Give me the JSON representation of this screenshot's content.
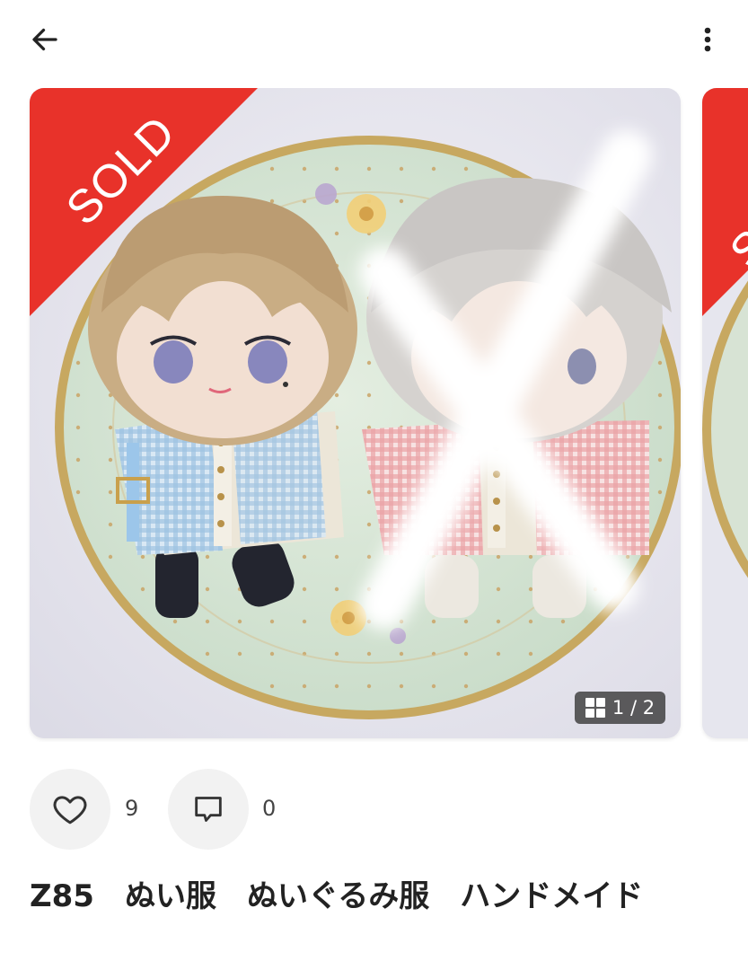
{
  "header": {
    "back_icon": "arrow-left-icon",
    "menu_icon": "more-vertical-icon"
  },
  "gallery": {
    "sold_label": "SOLD",
    "counter_icon": "grid-icon",
    "counter_text": "1 / 2",
    "current_index": 1,
    "total": 2,
    "sold_banner_color": "#e8322a"
  },
  "actions": {
    "like_icon": "heart-outline-icon",
    "like_count": "9",
    "comment_icon": "speech-bubble-icon",
    "comment_count": "0"
  },
  "item": {
    "title": "Z85　ぬい服　ぬいぐるみ服　ハンドメイド"
  }
}
